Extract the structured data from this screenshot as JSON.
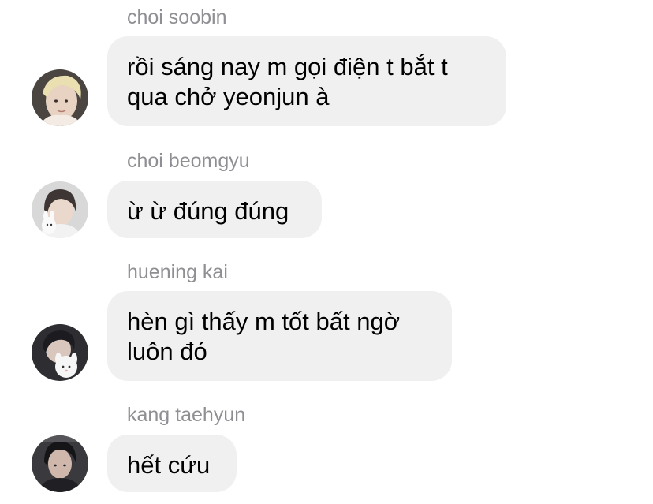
{
  "messages": [
    {
      "sender": "choi soobin",
      "lines": [
        "rồi sáng nay m gọi điện t bắt t",
        "qua chở yeonjun à"
      ],
      "avatar_icon": "profile-photo-blonde-hair"
    },
    {
      "sender": "choi beomgyu",
      "lines": [
        "ừ ừ đúng đúng"
      ],
      "avatar_icon": "profile-photo-with-plush-toy"
    },
    {
      "sender": "huening kai",
      "lines": [
        "hèn gì thấy m tốt bất ngờ",
        "luôn đó"
      ],
      "avatar_icon": "profile-photo-with-plush-toy"
    },
    {
      "sender": "kang taehyun",
      "lines": [
        "hết cứu"
      ],
      "avatar_icon": "profile-photo-dark-hair"
    }
  ],
  "colors": {
    "bubble_bg": "#f0f0f0",
    "sender_text": "#8e8e93",
    "message_text": "#000000"
  }
}
